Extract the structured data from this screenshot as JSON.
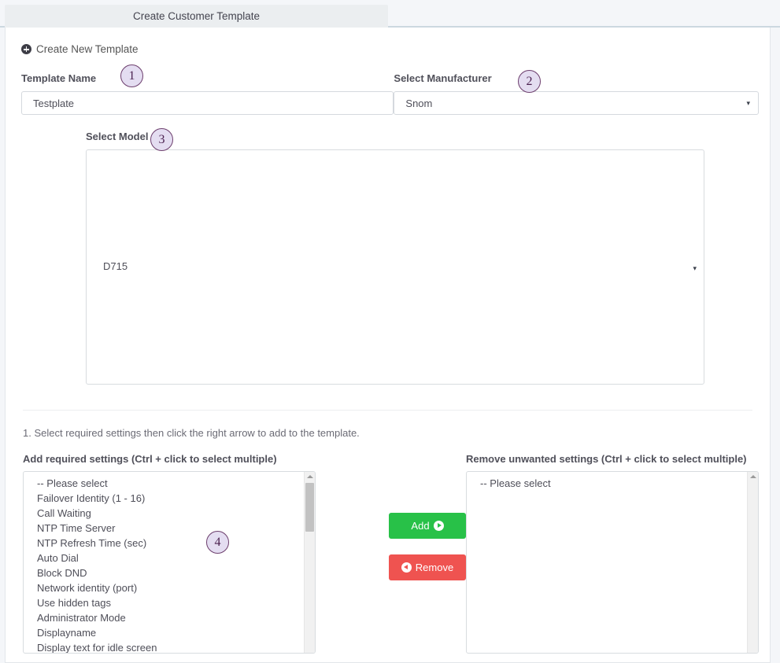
{
  "tab": {
    "label": "Create Customer Template"
  },
  "panel": {
    "section_title": "Create New Template",
    "section_icon": "plus-circle-icon"
  },
  "form": {
    "template_name": {
      "label": "Template Name",
      "value": "Testplate",
      "placeholder": ""
    },
    "manufacturer": {
      "label": "Select Manufacturer",
      "value": "Snom",
      "caret": "▾"
    },
    "model": {
      "label": "Select Model",
      "value": "D715",
      "caret": "▾"
    }
  },
  "annotations": [
    {
      "id": "1",
      "target": "template-name-field"
    },
    {
      "id": "2",
      "target": "manufacturer-select"
    },
    {
      "id": "3",
      "target": "model-select"
    },
    {
      "id": "4",
      "target": "add-settings-listbox"
    }
  ],
  "instruction": "1. Select required settings then click the right arrow to add to the template.",
  "add_list": {
    "label": "Add required settings (Ctrl + click to select multiple)",
    "items": [
      "-- Please select",
      "Failover Identity (1 - 16)",
      "Call Waiting",
      "NTP Time Server",
      "NTP Refresh Time (sec)",
      "Auto Dial",
      "Block DND",
      "Network identity (port)",
      "Use hidden tags",
      "Administrator Mode",
      "Displayname",
      "Display text for idle screen"
    ]
  },
  "remove_list": {
    "label": "Remove unwanted settings (Ctrl + click to select multiple)",
    "items": [
      "-- Please select"
    ]
  },
  "buttons": {
    "add": {
      "label": "Add",
      "icon": "arrow-right-circle-icon",
      "color": "#28c148"
    },
    "remove": {
      "label": "Remove",
      "icon": "arrow-left-circle-icon",
      "color": "#ef5350"
    }
  },
  "colors": {
    "page_background": "#f4f6f9",
    "tab_active": "#ebeef0",
    "tab_border": "#ccd8e0",
    "annotation_fill": "#e4ddf1",
    "annotation_stroke": "#6d3f6e"
  }
}
